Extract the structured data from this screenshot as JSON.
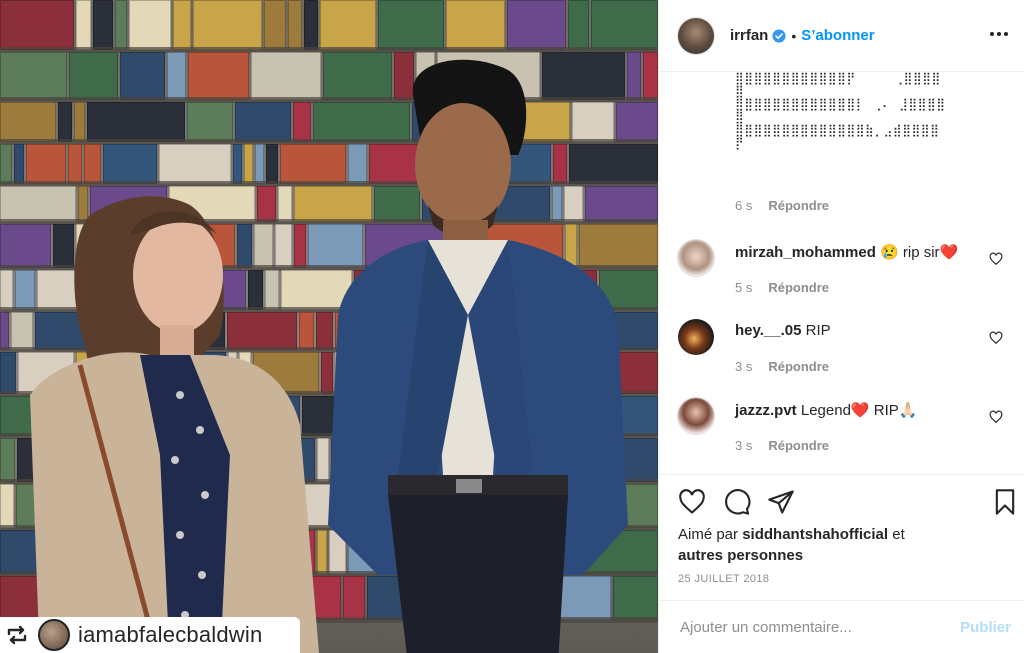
{
  "photo": {
    "repost_user": "iamabfalecbaldwin"
  },
  "header": {
    "username": "irrfan",
    "separator": "•",
    "follow_label": "S’abonner"
  },
  "comments": {
    "ascii_art": "⣿⣿⣿⣿⣿⣿⣿⣿⣿⣿⣿⣿⡟     ⢀⣿⣿⣿⣿\n⣿\n⣿⣿⣿⣿⣿⣿⣿⣿⣿⣿⣿⣿⣿⡇ ⢀⠄ ⣸⣿⣿⣿⣿\n⣿\n⣿⣿⣿⣿⣿⣿⣿⣿⣿⣿⣿⣿⣿⣿⣷⡀⣠⣾⣿⣿⣿⣿\n⡟",
    "ascii_time": "6 s",
    "reply_label": "Répondre",
    "items": [
      {
        "user": "mirzah_mohammed",
        "text": "😢 rip sir❤️",
        "time": "5 s"
      },
      {
        "user": "hey.__.05",
        "text": "RIP",
        "time": "3 s"
      },
      {
        "user": "jazzz.pvt",
        "text": "Legend❤️  RIP🙏🏻",
        "time": "3 s"
      }
    ]
  },
  "likes": {
    "prefix": "Aimé par ",
    "user": "siddhantshahofficial",
    "suffix": " et",
    "others": "autres personnes"
  },
  "date": "25 JUILLET 2018",
  "add_comment": {
    "placeholder": "Ajouter un commentaire...",
    "publish_label": "Publier"
  },
  "colors": {
    "accent": "#0095f6",
    "publish_disabled": "#b2dffc",
    "muted": "#8e8e8e",
    "heart_red": "#ed4956"
  }
}
